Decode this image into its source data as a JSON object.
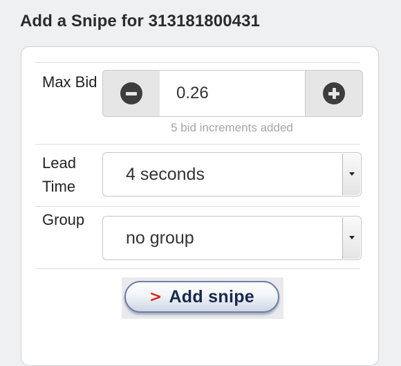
{
  "page": {
    "title": "Add a Snipe for 313181800431"
  },
  "form": {
    "max_bid": {
      "label": "Max Bid",
      "value": "0.26",
      "hint": "5 bid increments added",
      "decrement_icon": "minus-circle-icon",
      "increment_icon": "plus-circle-icon"
    },
    "lead_time": {
      "label": "Lead Time",
      "selected": "4 seconds"
    },
    "group": {
      "label": "Group",
      "selected": "no group"
    },
    "submit": {
      "chevron": ">",
      "label": "Add snipe"
    }
  },
  "colors": {
    "background": "#eef0f2",
    "panel": "#ffffff",
    "submit_text": "#16294f",
    "submit_chevron": "#d42a1a",
    "hint_text": "#a5a5a5"
  }
}
